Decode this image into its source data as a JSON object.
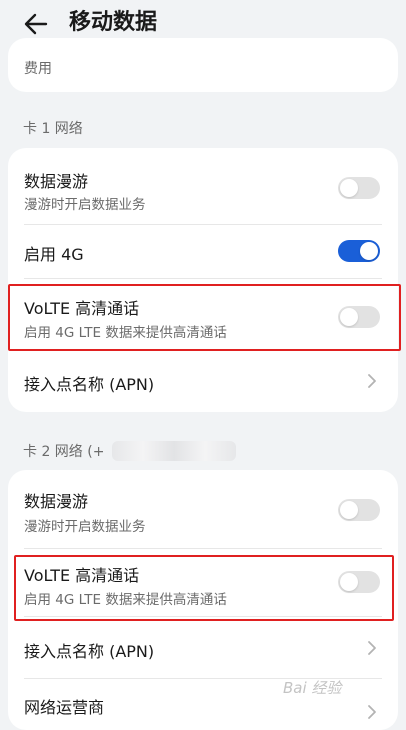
{
  "header": {
    "title": "移动数据",
    "back_icon": "arrow-left-icon"
  },
  "top_card": {
    "partial_text": "费用"
  },
  "sim1": {
    "section_label": "卡 1 网络",
    "roaming": {
      "label": "数据漫游",
      "sub": "漫游时开启数据业务",
      "enabled": false
    },
    "enable_4g": {
      "label": "启用 4G",
      "enabled": true
    },
    "volte": {
      "label": "VoLTE 高清通话",
      "sub": "启用 4G LTE 数据来提供高清通话",
      "enabled": false
    },
    "apn": {
      "label": "接入点名称 (APN)"
    }
  },
  "sim2": {
    "section_label": "卡 2 网络 (+",
    "roaming": {
      "label": "数据漫游",
      "sub": "漫游时开启数据业务",
      "enabled": false
    },
    "volte": {
      "label": "VoLTE 高清通话",
      "sub": "启用 4G LTE 数据来提供高清通话",
      "enabled": false
    },
    "apn": {
      "label": "接入点名称 (APN)"
    },
    "operator": {
      "label": "网络运营商"
    }
  },
  "watermark": {
    "text": "Bai 经验"
  },
  "colors": {
    "accent": "#1a5fd8",
    "highlight": "#e02020",
    "background": "#f1f3f5"
  }
}
